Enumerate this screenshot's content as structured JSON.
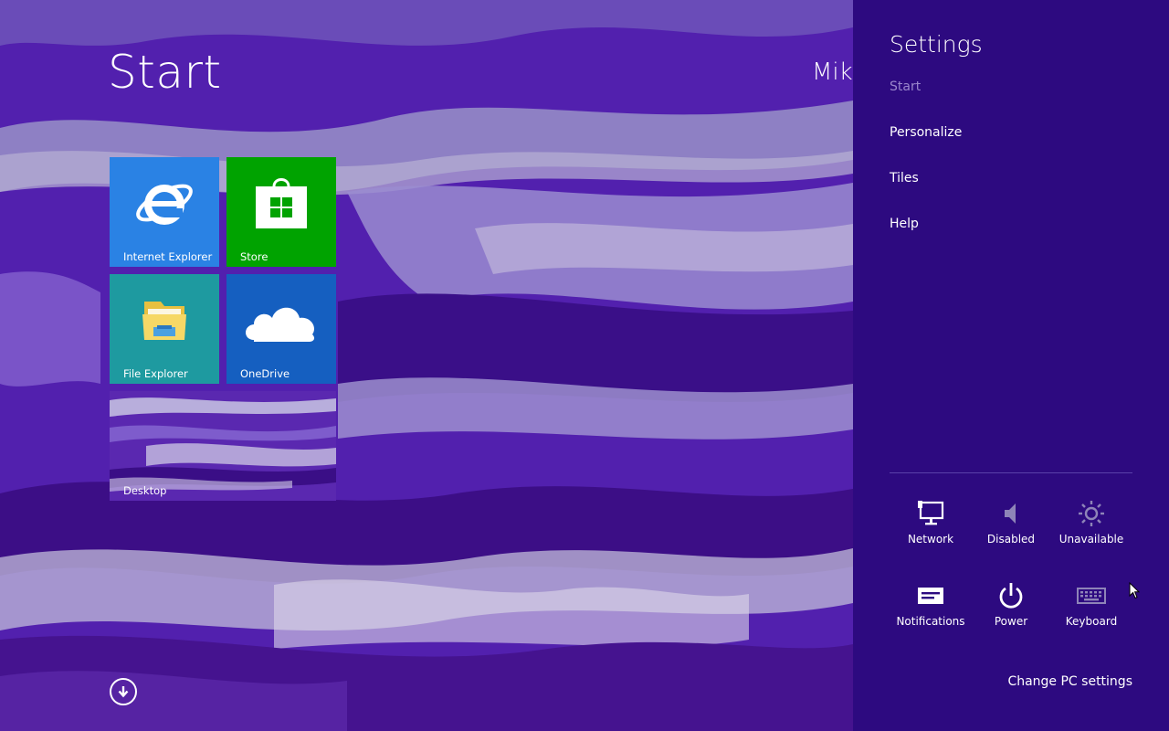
{
  "start": {
    "title": "Start",
    "user_name": "Mike",
    "tiles": [
      {
        "label": "Internet Explorer",
        "color": "#2a82e4",
        "icon": "internet-explorer-icon"
      },
      {
        "label": "Store",
        "color": "#00a300",
        "icon": "store-bag-icon"
      },
      {
        "label": "File Explorer",
        "color": "#1e9aa0",
        "icon": "folder-icon"
      },
      {
        "label": "OneDrive",
        "color": "#155fc0",
        "icon": "cloud-icon"
      },
      {
        "label": "Desktop",
        "color": "#5a28b0",
        "icon": "desktop-wallpaper-thumbnail"
      }
    ],
    "all_apps_icon": "down-arrow-circle-icon"
  },
  "settings": {
    "title": "Settings",
    "context_label": "Start",
    "links": {
      "personalize": "Personalize",
      "tiles": "Tiles",
      "help": "Help"
    },
    "quick_settings": {
      "network": "Network",
      "volume": "Disabled",
      "brightness": "Unavailable",
      "notifications": "Notifications",
      "power": "Power",
      "keyboard": "Keyboard"
    },
    "change_pc_settings": "Change PC settings",
    "colors": {
      "pane_background": "#2d0a80",
      "muted_text": "#9a86cc"
    }
  }
}
